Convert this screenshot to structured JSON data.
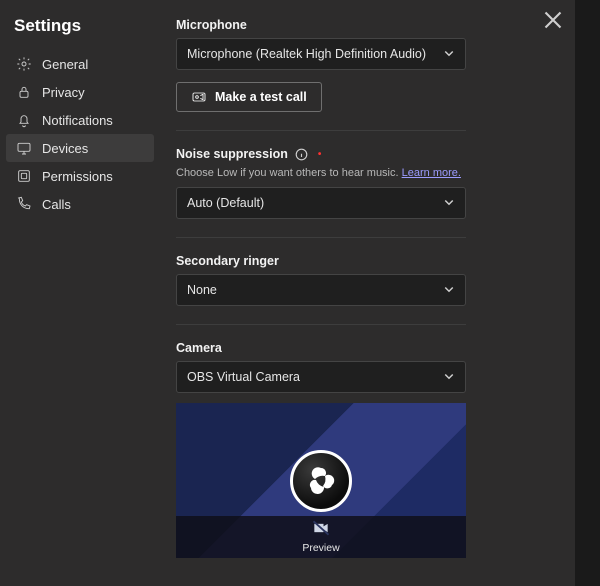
{
  "title": "Settings",
  "sidebar": {
    "items": [
      {
        "label": "General",
        "icon": "gear-icon",
        "active": false
      },
      {
        "label": "Privacy",
        "icon": "lock-icon",
        "active": false
      },
      {
        "label": "Notifications",
        "icon": "bell-icon",
        "active": false
      },
      {
        "label": "Devices",
        "icon": "monitor-icon",
        "active": true
      },
      {
        "label": "Permissions",
        "icon": "permissions-icon",
        "active": false
      },
      {
        "label": "Calls",
        "icon": "phone-icon",
        "active": false
      }
    ]
  },
  "sections": {
    "microphone": {
      "label": "Microphone",
      "value": "Microphone (Realtek High Definition Audio)",
      "test_call_button": "Make a test call"
    },
    "noise_suppression": {
      "label": "Noise suppression",
      "sub_text": "Choose Low if you want others to hear music.",
      "learn_more": "Learn more.",
      "value": "Auto (Default)"
    },
    "secondary_ringer": {
      "label": "Secondary ringer",
      "value": "None"
    },
    "camera": {
      "label": "Camera",
      "value": "OBS Virtual Camera",
      "preview_label": "Preview"
    }
  },
  "close_label": "Close"
}
